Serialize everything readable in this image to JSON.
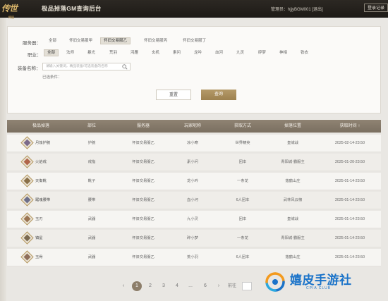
{
  "header": {
    "logo_text": "传世",
    "logo_sub": "怀旧",
    "title": "极品掉落GM查询后台",
    "admin_label": "管理员：",
    "admin_name": "hjjyBGM001",
    "exit_link": "[退出]",
    "logout_label": "登录记录"
  },
  "filters": {
    "server_label": "服务器：",
    "servers": [
      "全部",
      "怀旧交易服甲",
      "怀旧交易服乙",
      "怀旧交易服丙",
      "怀旧交易服丁"
    ],
    "server_selected": 2,
    "class_label": "职业：",
    "classes": [
      "全部",
      "法师",
      "暴光",
      "荒羽",
      "鸿雁",
      "玄机",
      "素问",
      "龙吟",
      "血河",
      "九灵",
      "碎梦",
      "神相",
      "铁衣"
    ],
    "class_selected": 0,
    "equip_label": "装备名称：",
    "equip_placeholder": "请输入关键词，精品装备/可选装备的名称",
    "selected_label": "已选条件：",
    "reset_label": "重置",
    "query_label": "查询"
  },
  "table": {
    "headers": [
      "极品掉落",
      "部位",
      "服务器",
      "玩家昵称",
      "获取方式",
      "掉落位置",
      "获取时间 ↑"
    ],
    "rows": [
      {
        "name": "月蚀护腕",
        "slot": "护腕",
        "server": "怀旧交易服乙",
        "player": "凉小寒",
        "method": "世界精英",
        "location": "皇城战",
        "time": "2025-02-14-23:50",
        "gem_color": "#7b6a8a"
      },
      {
        "name": "火焰戒",
        "slot": "戒指",
        "server": "怀旧交易服乙",
        "player": "素小问",
        "method": "团本",
        "location": "青阳城·霸服主",
        "time": "2025-01-20-23:50",
        "gem_color": "#b0654a"
      },
      {
        "name": "天衡靴",
        "slot": "靴子",
        "server": "怀旧交易服乙",
        "player": "龙小吟",
        "method": "一条龙",
        "location": "落鹤山庄",
        "time": "2025-01-14-23:50",
        "gem_color": "#8a7048"
      },
      {
        "name": "踞魂腰带",
        "slot": "腰带",
        "server": "怀旧交易服乙",
        "player": "血小河",
        "method": "6人团本",
        "location": "武林风云榜",
        "time": "2025-01-14-23:50",
        "gem_color": "#6d6f8a"
      },
      {
        "name": "玉刃",
        "slot": "武器",
        "server": "怀旧交易服乙",
        "player": "九小灵",
        "method": "团本",
        "location": "皇城战",
        "time": "2025-01-14-23:50",
        "gem_color": "#9a7452"
      },
      {
        "name": "镇星",
        "slot": "武器",
        "server": "怀旧交易服乙",
        "player": "碎小梦",
        "method": "一条龙",
        "location": "青阳城·霸服主",
        "time": "2025-01-14-23:50",
        "gem_color": "#7a6950"
      },
      {
        "name": "玉骨",
        "slot": "武器",
        "server": "怀旧交易服乙",
        "player": "荒小羽",
        "method": "6人团本",
        "location": "落鹤山庄",
        "time": "2025-01-14-23:50",
        "gem_color": "#8e6e5a"
      }
    ]
  },
  "pagination": {
    "prev": "‹",
    "pages": [
      "1",
      "2",
      "3",
      "4",
      "...",
      "6"
    ],
    "current": "1",
    "next": "›",
    "goto_label": "前往"
  },
  "watermark": {
    "text": "嬉皮手游社",
    "sub": "CPIA CLUB",
    "color": "#1a73c9"
  },
  "colors": {
    "accent": "#9d814f",
    "header_bg": "#2c2823",
    "table_header": "#8f8373"
  }
}
